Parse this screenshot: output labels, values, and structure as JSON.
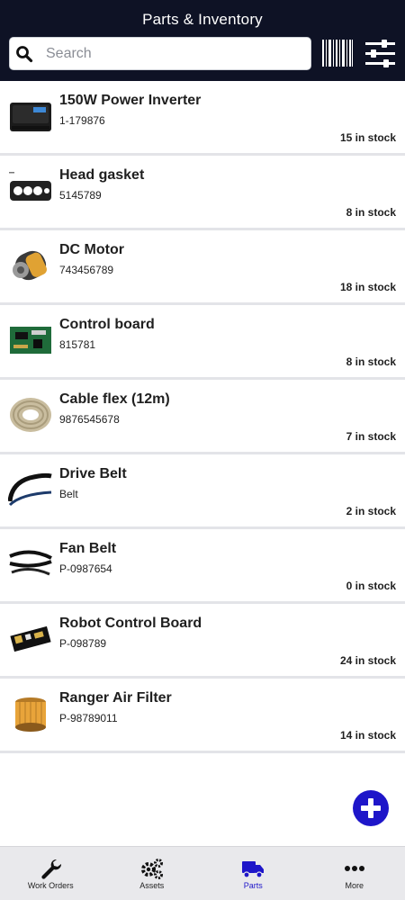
{
  "header": {
    "title": "Parts & Inventory"
  },
  "search": {
    "placeholder": "Search",
    "value": ""
  },
  "parts": [
    {
      "name": "150W Power Inverter",
      "code": "1-179876",
      "stock": "15 in stock",
      "icon": "power-inverter-thumbnail"
    },
    {
      "name": "Head gasket",
      "code": "5145789",
      "stock": "8 in stock",
      "icon": "head-gasket-thumbnail"
    },
    {
      "name": "DC Motor",
      "code": "743456789",
      "stock": "18 in stock",
      "icon": "dc-motor-thumbnail"
    },
    {
      "name": "Control board",
      "code": "815781",
      "stock": "8 in stock",
      "icon": "control-board-thumbnail"
    },
    {
      "name": "Cable flex (12m)",
      "code": "9876545678",
      "stock": "7 in stock",
      "icon": "cable-coil-thumbnail"
    },
    {
      "name": "Drive Belt",
      "code": "Belt",
      "stock": "2 in stock",
      "icon": "drive-belt-thumbnail"
    },
    {
      "name": "Fan Belt",
      "code": "P-0987654",
      "stock": "0 in stock",
      "icon": "fan-belt-thumbnail"
    },
    {
      "name": "Robot Control Board",
      "code": "P-098789",
      "stock": "24 in stock",
      "icon": "robot-board-thumbnail"
    },
    {
      "name": "Ranger Air Filter",
      "code": "P-98789011",
      "stock": "14 in stock",
      "icon": "air-filter-thumbnail"
    }
  ],
  "tabs": [
    {
      "label": "Work Orders",
      "icon": "wrench-icon",
      "active": false
    },
    {
      "label": "Assets",
      "icon": "gears-icon",
      "active": false
    },
    {
      "label": "Parts",
      "icon": "truck-icon",
      "active": true
    },
    {
      "label": "More",
      "icon": "more-dots-icon",
      "active": false
    }
  ],
  "colors": {
    "header_bg": "#0e1225",
    "accent": "#1e16c9",
    "tabbar_bg": "#e9e9ec",
    "divider": "#e3e4e8"
  }
}
